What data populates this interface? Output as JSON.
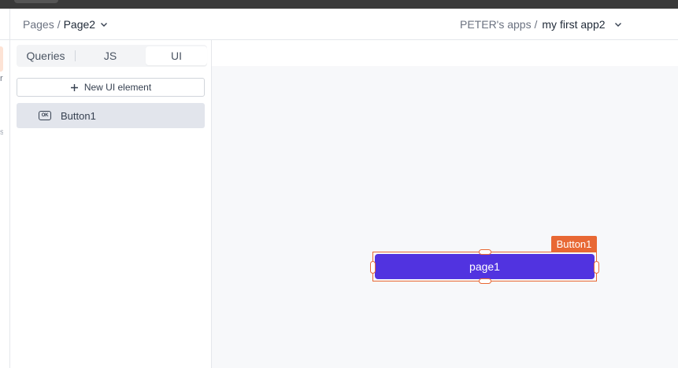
{
  "header": {
    "pages_label": "Pages",
    "separator": "/",
    "current_page": "Page2",
    "workspace_label": "PETER's apps /",
    "app_name": "my first app2"
  },
  "left_rail": {
    "partial_text_1": "r",
    "partial_text_2": "s"
  },
  "panel": {
    "tabs": [
      {
        "label": "Queries"
      },
      {
        "label": "JS"
      },
      {
        "label": "UI",
        "active": true
      }
    ],
    "new_element_label": "New UI element",
    "tree": [
      {
        "label": "Button1",
        "icon": "button-icon",
        "icon_text": "OK",
        "selected": true
      }
    ]
  },
  "canvas": {
    "selected_widget_name": "Button1",
    "button_label": "page1"
  },
  "colors": {
    "accent": "#e86834",
    "button": "#5133e0",
    "selected_row": "#e2e5ec",
    "canvas_bg": "#f7f8fa"
  }
}
